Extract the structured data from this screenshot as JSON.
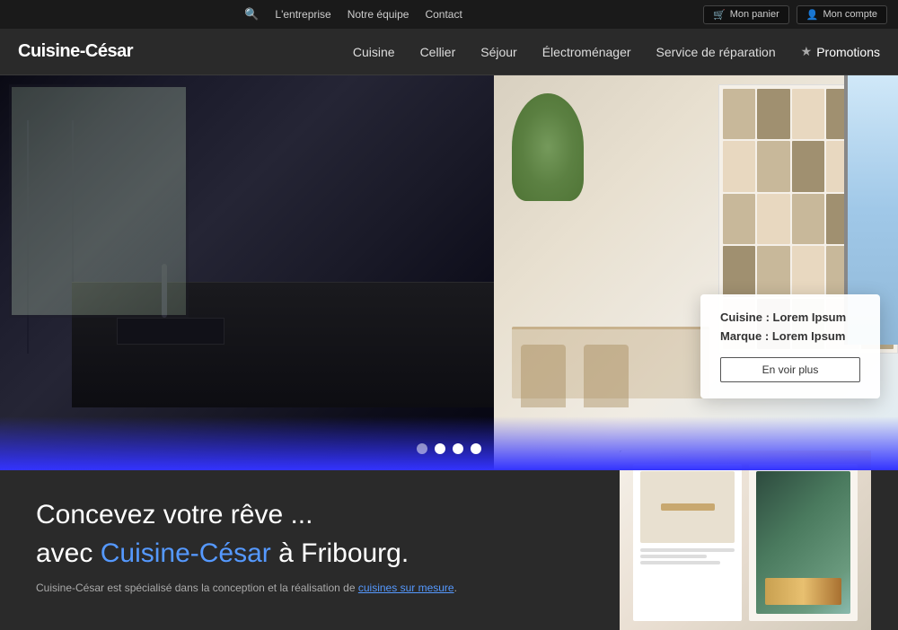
{
  "topbar": {
    "search_label": "🔍",
    "links": [
      {
        "id": "lentreprise",
        "label": "L'entreprise"
      },
      {
        "id": "notre-equipe",
        "label": "Notre équipe"
      },
      {
        "id": "contact",
        "label": "Contact"
      }
    ],
    "cart_btn": "Mon panier",
    "account_btn": "Mon compte",
    "cart_icon": "🛒",
    "account_icon": "👤"
  },
  "navbar": {
    "logo": "Cuisine-César",
    "nav_items": [
      {
        "id": "cuisine",
        "label": "Cuisine"
      },
      {
        "id": "cellier",
        "label": "Cellier"
      },
      {
        "id": "sejour",
        "label": "Séjour"
      },
      {
        "id": "electromenager",
        "label": "Électroménager"
      },
      {
        "id": "service-reparation",
        "label": "Service de réparation"
      },
      {
        "id": "promotions",
        "label": "Promotions",
        "is_promo": true
      }
    ]
  },
  "hero": {
    "info_card": {
      "cuisine_label": "Cuisine",
      "cuisine_value": "Lorem Ipsum",
      "marque_label": "Marque",
      "marque_value": "Lorem Ipsum",
      "btn_label": "En voir plus"
    },
    "dots": [
      {
        "id": 1,
        "active": false
      },
      {
        "id": 2,
        "active": true
      },
      {
        "id": 3,
        "active": true
      },
      {
        "id": 4,
        "active": true
      }
    ]
  },
  "bottom": {
    "headline_line1": "Concevez votre rêve ...",
    "headline_line2_prefix": "avec ",
    "headline_brand": "Cuisine-César",
    "headline_line2_suffix": " à Fribourg.",
    "subtext_prefix": "Cuisine-César est spécialisé dans la conception et la réalisation de ",
    "subtext_link": "cuisines sur mesure",
    "subtext_suffix": "."
  }
}
